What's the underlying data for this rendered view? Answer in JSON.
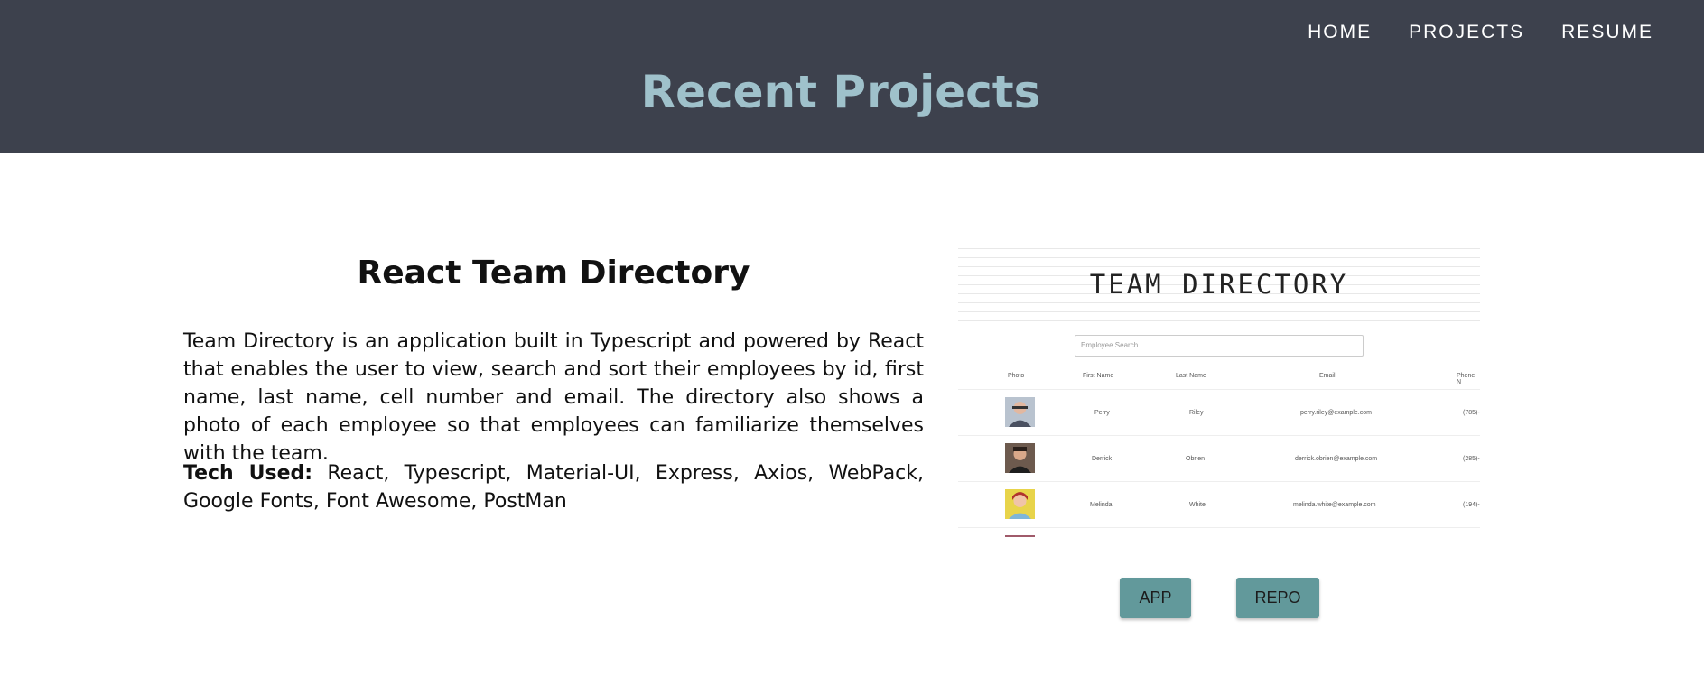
{
  "nav": {
    "items": [
      "HOME",
      "PROJECTS",
      "RESUME"
    ]
  },
  "page_title": "Recent Projects",
  "project": {
    "title": "React Team Directory",
    "description": "Team Directory is an application built in Typescript and powered by React that enables the user to view, search and sort their employees by id, first name, last name, cell number and email. The directory also shows a photo of each employee so that employees can familiarize themselves with the team.",
    "tech_label": "Tech Used:",
    "tech_list": " React, Typescript, Material-UI, Express, Axios, WebPack, Google Fonts, Font Awesome, PostMan",
    "buttons": {
      "app": "APP",
      "repo": "REPO"
    }
  },
  "screenshot": {
    "title": "TEAM DIRECTORY",
    "search_placeholder": "Employee Search",
    "columns": [
      "Photo",
      "First Name",
      "Last Name",
      "Email",
      "Phone N"
    ],
    "rows": [
      {
        "first": "Perry",
        "last": "Riley",
        "email": "perry.riley@example.com",
        "phone": "(785)-"
      },
      {
        "first": "Derrick",
        "last": "Obrien",
        "email": "derrick.obrien@example.com",
        "phone": "(285)-"
      },
      {
        "first": "Melinda",
        "last": "White",
        "email": "melinda.white@example.com",
        "phone": "(194)-"
      }
    ]
  },
  "colors": {
    "header_bg": "#3d414d",
    "title_color": "#9fc1cb",
    "button_bg": "#62999b"
  }
}
